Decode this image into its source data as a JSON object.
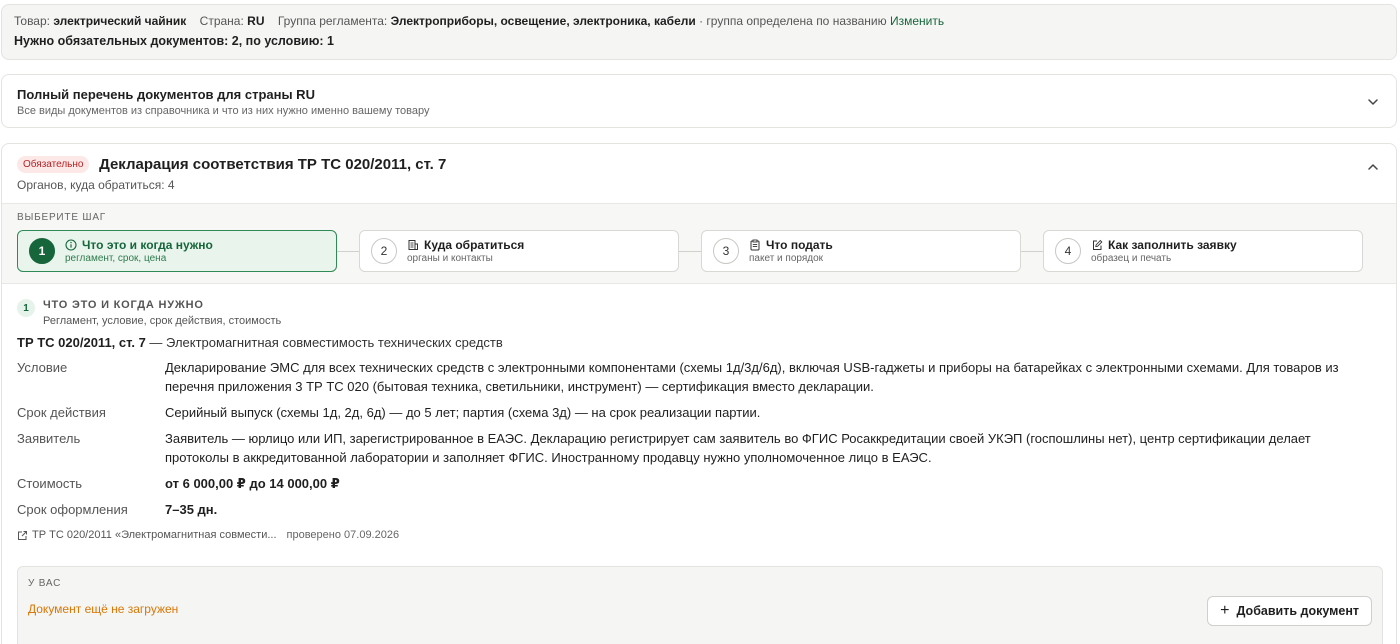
{
  "summary": {
    "product_label": "Товар:",
    "product_value": "электрический чайник",
    "country_label": "Страна:",
    "country_value": "RU",
    "group_label": "Группа регламента:",
    "group_value": "Электроприборы, освещение, электроника, кабели",
    "group_note": "· группа определена по названию",
    "change_link": "Изменить",
    "required_line": "Нужно обязательных документов: 2, по условию: 1"
  },
  "full_list": {
    "title": "Полный перечень документов для страны RU",
    "subtitle": "Все виды документов из справочника и что из них нужно именно вашему товару"
  },
  "document": {
    "badge": "Обязательно",
    "title": "Декларация соответствия ТР ТС 020/2011, ст. 7",
    "subtitle": "Органов, куда обратиться: 4"
  },
  "steps": {
    "label": "ВЫБЕРИТЕ ШАГ",
    "items": [
      {
        "num": "1",
        "title": "Что это и когда нужно",
        "sub": "регламент, срок, цена",
        "icon": "info-icon"
      },
      {
        "num": "2",
        "title": "Куда обратиться",
        "sub": "органы и контакты",
        "icon": "building-icon"
      },
      {
        "num": "3",
        "title": "Что подать",
        "sub": "пакет и порядок",
        "icon": "clipboard-icon"
      },
      {
        "num": "4",
        "title": "Как заполнить заявку",
        "sub": "образец и печать",
        "icon": "edit-icon"
      }
    ]
  },
  "section": {
    "num": "1",
    "title": "ЧТО ЭТО И КОГДА НУЖНО",
    "subtitle": "Регламент, условие, срок действия, стоимость",
    "reg_code": "ТР ТС 020/2011, ст. 7",
    "reg_name": " — Электромагнитная совместимость технических средств",
    "rows": [
      {
        "key": "Условие",
        "value": "Декларирование ЭМС для всех технических средств с электронными компонентами (схемы 1д/3д/6д), включая USB-гаджеты и приборы на батарейках с электронными схемами. Для товаров из перечня приложения 3 ТР ТС 020 (бытовая техника, светильники, инструмент) — сертификация вместо декларации."
      },
      {
        "key": "Срок действия",
        "value": "Серийный выпуск (схемы 1д, 2д, 6д) — до 5 лет; партия (схема 3д) — на срок реализации партии."
      },
      {
        "key": "Заявитель",
        "value": "Заявитель — юрлицо или ИП, зарегистрированное в ЕАЭС. Декларацию регистрирует сам заявитель во ФГИС Росаккредитации своей УКЭП (госпошлины нет), центр сертификации делает протоколы в аккредитованной лаборатории и заполняет ФГИС. Иностранному продавцу нужно уполномоченное лицо в ЕАЭС."
      },
      {
        "key": "Стоимость",
        "value": "от 6 000,00 ₽ до 14 000,00 ₽"
      },
      {
        "key": "Срок оформления",
        "value": "7–35 дн."
      }
    ],
    "source_link": "ТР ТС 020/2011 «Электромагнитная совмести...",
    "checked": "проверено 07.09.2026"
  },
  "have": {
    "label": "У ВАС",
    "status": "Документ ещё не загружен",
    "add_button": "Добавить документ"
  },
  "colors": {
    "accent": "#17663b",
    "badge_bg": "#fde8e8",
    "badge_text": "#b32424",
    "warning": "#d97706"
  }
}
